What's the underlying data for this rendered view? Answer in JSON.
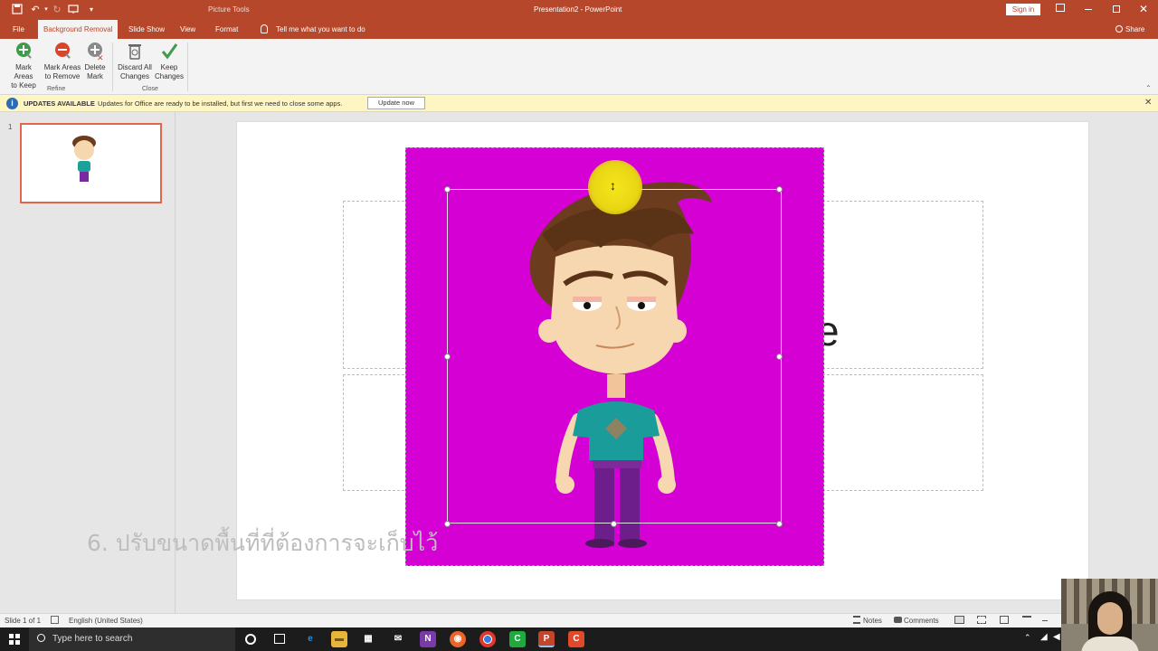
{
  "title_bar": {
    "context": "Picture Tools",
    "document": "Presentation2 - PowerPoint",
    "sign_in": "Sign in"
  },
  "tabs": {
    "file": "File",
    "background_removal": "Background Removal",
    "slide_show": "Slide Show",
    "view": "View",
    "format": "Format",
    "tell_me": "Tell me what you want to do",
    "share": "Share"
  },
  "ribbon": {
    "mark_keep_1": "Mark Areas",
    "mark_keep_2": "to Keep",
    "mark_remove_1": "Mark Areas",
    "mark_remove_2": "to Remove",
    "delete_mark_1": "Delete",
    "delete_mark_2": "Mark",
    "discard_1": "Discard All",
    "discard_2": "Changes",
    "keep_1": "Keep",
    "keep_2": "Changes",
    "group_refine": "Refine",
    "group_close": "Close"
  },
  "notification": {
    "title": "UPDATES AVAILABLE",
    "message": "Updates for Office are ready to be installed, but first we need to close some apps.",
    "button": "Update now"
  },
  "thumbnails": {
    "slide_number": "1"
  },
  "slide": {
    "caption": "6. ปรับขนาดพื้นที่ที่ต้องการจะเก็บไว้",
    "partial_text": "e"
  },
  "status_bar": {
    "slide_info": "Slide 1 of 1",
    "language": "English (United States)",
    "notes": "Notes",
    "comments": "Comments"
  },
  "taskbar": {
    "search_placeholder": "Type here to search"
  },
  "colors": {
    "accent": "#b7472a",
    "magenta_background": "#d400d4",
    "notice_bg": "#fdf6c3"
  }
}
